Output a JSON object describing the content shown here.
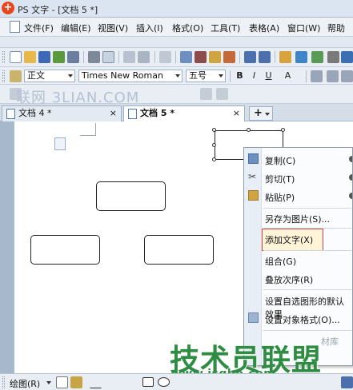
{
  "window": {
    "title": "PS 文字 - [文档 5 *]",
    "app_icon": "wps-logo-icon"
  },
  "menu": [
    {
      "label": "文件(F)"
    },
    {
      "label": "编辑(E)"
    },
    {
      "label": "视图(V)"
    },
    {
      "label": "插入(I)"
    },
    {
      "label": "格式(O)"
    },
    {
      "label": "工具(T)"
    },
    {
      "label": "表格(A)"
    },
    {
      "label": "窗口(W)"
    },
    {
      "label": "帮助"
    }
  ],
  "format_toolbar": {
    "style": "正文",
    "font": "Times New Roman",
    "size": "五号",
    "bold": "B",
    "italic": "I",
    "underline": "U",
    "char_scale": "A"
  },
  "tabs": [
    {
      "label": "文档 4 *",
      "close": "×"
    },
    {
      "label": "文档 5 *",
      "close": "×",
      "active": true
    }
  ],
  "new_tab": "+",
  "watermark": "联网 3LIAN.COM",
  "context_menu": {
    "items": [
      {
        "label": "复制(C)",
        "icon": "copy-icon"
      },
      {
        "label": "剪切(T)",
        "icon": "cut-icon"
      },
      {
        "label": "粘贴(P)",
        "icon": "paste-icon"
      },
      {
        "label": "另存为图片(S)..."
      },
      {
        "label": "添加文字(X)",
        "highlighted": true
      },
      {
        "label": "组合(G)"
      },
      {
        "label": "叠放次序(R)"
      },
      {
        "label": "设置自选图形的默认效果"
      },
      {
        "label": "设置对象格式(O)...",
        "icon": "format-object-icon"
      },
      {
        "label": "材库",
        "disabled": true
      }
    ]
  },
  "drawing_toolbar": {
    "label": "绘图(R)"
  },
  "brand": {
    "name": "技术员联盟",
    "url": "www.jsgho.com"
  },
  "colors": {
    "highlight_border": "#d0484f",
    "brand_green": "#2f8d43",
    "menu_bg": "#eef2f7"
  }
}
